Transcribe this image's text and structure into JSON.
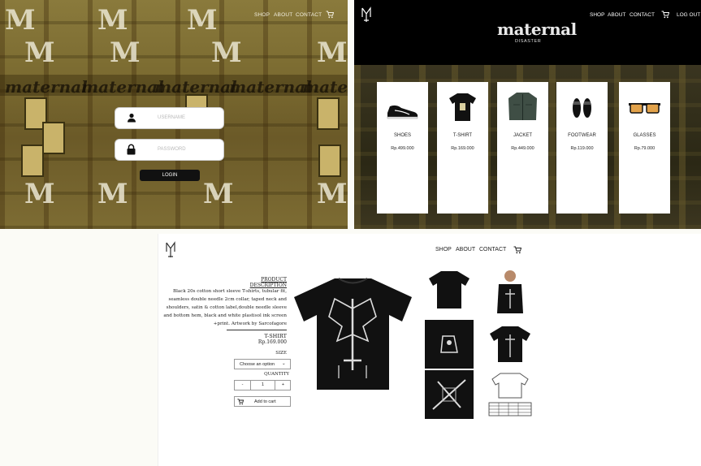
{
  "login": {
    "nav": [
      "SHOP",
      "ABOUT",
      "CONTACT"
    ],
    "cart_icon": "cart-icon",
    "username_placeholder": "USERNAME",
    "password_placeholder": "PASSWORD",
    "login_button": "LOGIN",
    "user_icon": "user-icon",
    "lock_icon": "lock-icon",
    "background_word": "maternal",
    "background_monogram": "M",
    "colors": {
      "background": "#7a6a30",
      "button": "#111111"
    }
  },
  "shop": {
    "brand_title": "maternal",
    "brand_subtitle": "DISASTER",
    "nav": [
      "SHOP",
      "ABOUT",
      "CONTACT",
      "LOG OUT"
    ],
    "cart_icon": "cart-icon",
    "products": [
      {
        "name": "SHOES",
        "price": "Rp.499.000",
        "icon": "sneaker-icon"
      },
      {
        "name": "T-SHIRT",
        "price": "Rp.169.000",
        "icon": "tshirt-icon"
      },
      {
        "name": "JACKET",
        "price": "Rp.449.000",
        "icon": "jacket-icon"
      },
      {
        "name": "FOOTWEAR",
        "price": "Rp.119.000",
        "icon": "slides-icon"
      },
      {
        "name": "GLASSES",
        "price": "Rp.79.000",
        "icon": "sunglasses-icon"
      }
    ],
    "colors": {
      "header": "#000000",
      "card": "#ffffff"
    }
  },
  "product": {
    "nav": [
      "SHOP",
      "ABOUT",
      "CONTACT"
    ],
    "cart_icon": "cart-icon",
    "description_heading": "PRODUCT DESCRIPTION",
    "description": "Black 20s cotton short sleeve T-shirts, tubular fit, seamless double needle 2cm collar, taped neck and shoulders, satin & cotton label,double needle sleeve and bottom hem, black and white plastisol ink screen +print. Artwork by Sarcofagore",
    "name": "T-SHIRT",
    "price": "Rp.169.000",
    "size_label": "SIZE",
    "size_select": "Choose an option",
    "quantity_label": "QUANTITY",
    "minus": "-",
    "quantity": "1",
    "plus": "+",
    "add_to_cart": "Add to cart",
    "gallery": [
      "tshirt-back",
      "model-front",
      "folded-print",
      "tshirt-front",
      "print-detail",
      "size-chart"
    ]
  }
}
